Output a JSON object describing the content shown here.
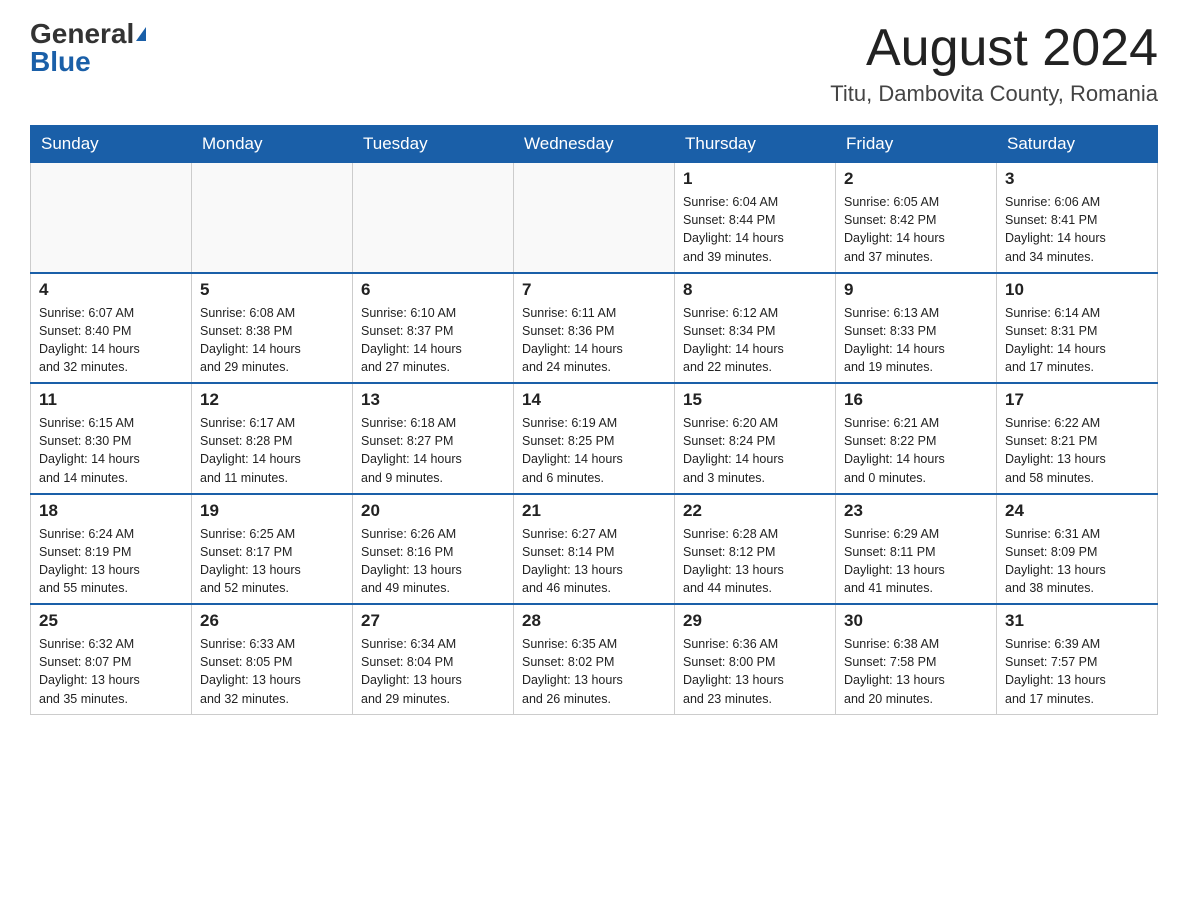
{
  "header": {
    "logo_general": "General",
    "logo_blue": "Blue",
    "month": "August 2024",
    "location": "Titu, Dambovita County, Romania"
  },
  "days_of_week": [
    "Sunday",
    "Monday",
    "Tuesday",
    "Wednesday",
    "Thursday",
    "Friday",
    "Saturday"
  ],
  "weeks": [
    [
      {
        "day": "",
        "info": ""
      },
      {
        "day": "",
        "info": ""
      },
      {
        "day": "",
        "info": ""
      },
      {
        "day": "",
        "info": ""
      },
      {
        "day": "1",
        "info": "Sunrise: 6:04 AM\nSunset: 8:44 PM\nDaylight: 14 hours\nand 39 minutes."
      },
      {
        "day": "2",
        "info": "Sunrise: 6:05 AM\nSunset: 8:42 PM\nDaylight: 14 hours\nand 37 minutes."
      },
      {
        "day": "3",
        "info": "Sunrise: 6:06 AM\nSunset: 8:41 PM\nDaylight: 14 hours\nand 34 minutes."
      }
    ],
    [
      {
        "day": "4",
        "info": "Sunrise: 6:07 AM\nSunset: 8:40 PM\nDaylight: 14 hours\nand 32 minutes."
      },
      {
        "day": "5",
        "info": "Sunrise: 6:08 AM\nSunset: 8:38 PM\nDaylight: 14 hours\nand 29 minutes."
      },
      {
        "day": "6",
        "info": "Sunrise: 6:10 AM\nSunset: 8:37 PM\nDaylight: 14 hours\nand 27 minutes."
      },
      {
        "day": "7",
        "info": "Sunrise: 6:11 AM\nSunset: 8:36 PM\nDaylight: 14 hours\nand 24 minutes."
      },
      {
        "day": "8",
        "info": "Sunrise: 6:12 AM\nSunset: 8:34 PM\nDaylight: 14 hours\nand 22 minutes."
      },
      {
        "day": "9",
        "info": "Sunrise: 6:13 AM\nSunset: 8:33 PM\nDaylight: 14 hours\nand 19 minutes."
      },
      {
        "day": "10",
        "info": "Sunrise: 6:14 AM\nSunset: 8:31 PM\nDaylight: 14 hours\nand 17 minutes."
      }
    ],
    [
      {
        "day": "11",
        "info": "Sunrise: 6:15 AM\nSunset: 8:30 PM\nDaylight: 14 hours\nand 14 minutes."
      },
      {
        "day": "12",
        "info": "Sunrise: 6:17 AM\nSunset: 8:28 PM\nDaylight: 14 hours\nand 11 minutes."
      },
      {
        "day": "13",
        "info": "Sunrise: 6:18 AM\nSunset: 8:27 PM\nDaylight: 14 hours\nand 9 minutes."
      },
      {
        "day": "14",
        "info": "Sunrise: 6:19 AM\nSunset: 8:25 PM\nDaylight: 14 hours\nand 6 minutes."
      },
      {
        "day": "15",
        "info": "Sunrise: 6:20 AM\nSunset: 8:24 PM\nDaylight: 14 hours\nand 3 minutes."
      },
      {
        "day": "16",
        "info": "Sunrise: 6:21 AM\nSunset: 8:22 PM\nDaylight: 14 hours\nand 0 minutes."
      },
      {
        "day": "17",
        "info": "Sunrise: 6:22 AM\nSunset: 8:21 PM\nDaylight: 13 hours\nand 58 minutes."
      }
    ],
    [
      {
        "day": "18",
        "info": "Sunrise: 6:24 AM\nSunset: 8:19 PM\nDaylight: 13 hours\nand 55 minutes."
      },
      {
        "day": "19",
        "info": "Sunrise: 6:25 AM\nSunset: 8:17 PM\nDaylight: 13 hours\nand 52 minutes."
      },
      {
        "day": "20",
        "info": "Sunrise: 6:26 AM\nSunset: 8:16 PM\nDaylight: 13 hours\nand 49 minutes."
      },
      {
        "day": "21",
        "info": "Sunrise: 6:27 AM\nSunset: 8:14 PM\nDaylight: 13 hours\nand 46 minutes."
      },
      {
        "day": "22",
        "info": "Sunrise: 6:28 AM\nSunset: 8:12 PM\nDaylight: 13 hours\nand 44 minutes."
      },
      {
        "day": "23",
        "info": "Sunrise: 6:29 AM\nSunset: 8:11 PM\nDaylight: 13 hours\nand 41 minutes."
      },
      {
        "day": "24",
        "info": "Sunrise: 6:31 AM\nSunset: 8:09 PM\nDaylight: 13 hours\nand 38 minutes."
      }
    ],
    [
      {
        "day": "25",
        "info": "Sunrise: 6:32 AM\nSunset: 8:07 PM\nDaylight: 13 hours\nand 35 minutes."
      },
      {
        "day": "26",
        "info": "Sunrise: 6:33 AM\nSunset: 8:05 PM\nDaylight: 13 hours\nand 32 minutes."
      },
      {
        "day": "27",
        "info": "Sunrise: 6:34 AM\nSunset: 8:04 PM\nDaylight: 13 hours\nand 29 minutes."
      },
      {
        "day": "28",
        "info": "Sunrise: 6:35 AM\nSunset: 8:02 PM\nDaylight: 13 hours\nand 26 minutes."
      },
      {
        "day": "29",
        "info": "Sunrise: 6:36 AM\nSunset: 8:00 PM\nDaylight: 13 hours\nand 23 minutes."
      },
      {
        "day": "30",
        "info": "Sunrise: 6:38 AM\nSunset: 7:58 PM\nDaylight: 13 hours\nand 20 minutes."
      },
      {
        "day": "31",
        "info": "Sunrise: 6:39 AM\nSunset: 7:57 PM\nDaylight: 13 hours\nand 17 minutes."
      }
    ]
  ]
}
